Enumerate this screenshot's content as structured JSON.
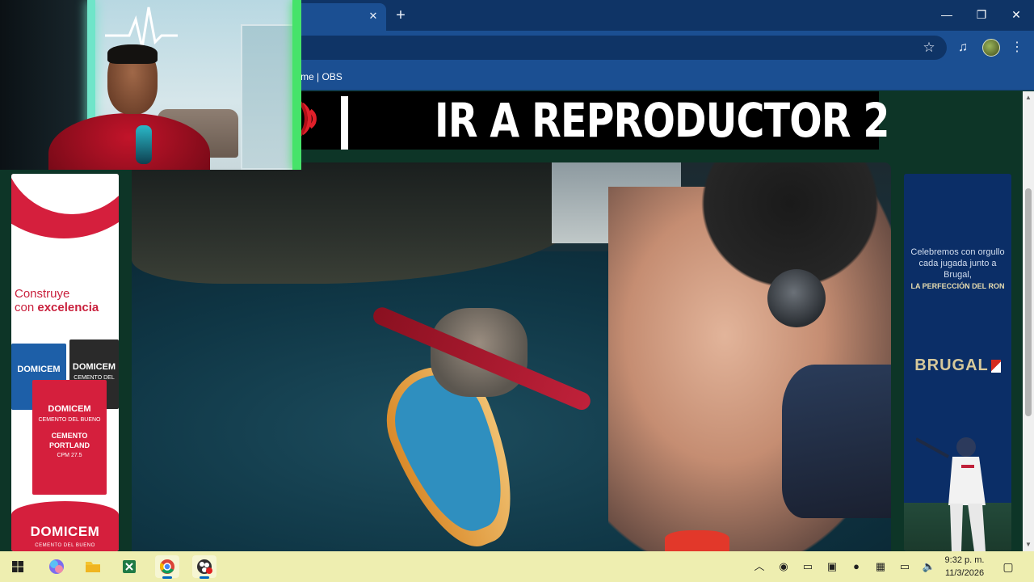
{
  "browser": {
    "tab_close": "✕",
    "new_tab": "+",
    "window_controls": {
      "minimize": "—",
      "maximize": "❐",
      "close": "✕"
    },
    "bookmarks_bar": {
      "item_label": "me | OBS"
    }
  },
  "page": {
    "player_banner": {
      "text": "IR A REPRODUCTOR 2"
    },
    "ad_left": {
      "tagline_part1": "Construye",
      "tagline_part2": "con",
      "tagline_bold": "excelencia",
      "bag_brand": "DOMICEM",
      "bag_small_sub": "CEMENTO DEL BUENO",
      "bag_front_line1": "CEMENTO",
      "bag_front_line2": "PORTLAND",
      "bag_front_line3": "CPM 27.5",
      "brand": "DOMICEM",
      "brand_sub": "CEMENTO DEL BUENO"
    },
    "ad_right": {
      "text": "Celebremos con orgullo cada jugada junto a Brugal,",
      "text_bold": "LA PERFECCIÓN DEL RON",
      "brand": "BRUGAL"
    }
  },
  "taskbar": {
    "start_icon": "windows-logo",
    "pinned": [
      "copilot-icon",
      "file-explorer-icon",
      "excel-icon",
      "chrome-icon",
      "obs-icon"
    ],
    "tray": {
      "overflow": "︿",
      "time": "9:32 p. m.",
      "date": "11/3/2026"
    }
  },
  "colors": {
    "browser_dark": "#0f3466",
    "browser_light": "#1b4f92",
    "page_bg": "#0d3527",
    "domicem_red": "#d51f3d",
    "brugal_blue": "#0b2e67",
    "taskbar": "#eeeeb0"
  }
}
